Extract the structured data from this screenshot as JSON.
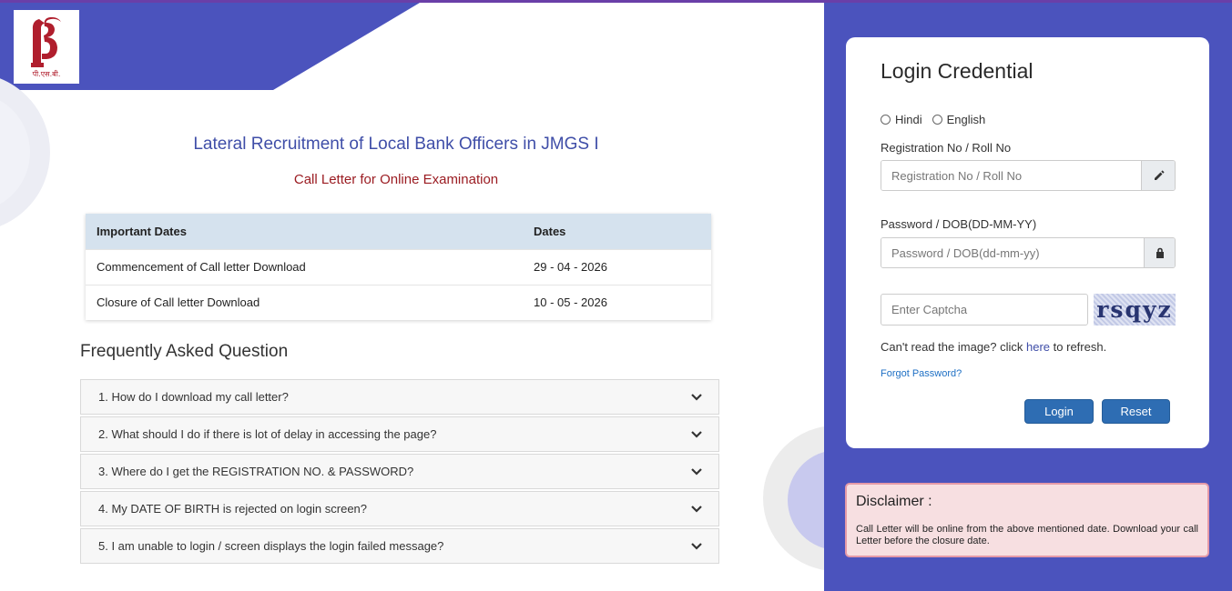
{
  "brand": {
    "logo_text": "पी.एस.बी.",
    "accent": "#4b53bd"
  },
  "header": {
    "title": "Lateral Recruitment of Local Bank Officers in JMGS I",
    "subtitle": "Call Letter for Online Examination"
  },
  "dates_table": {
    "columns": [
      "Important Dates",
      "Dates"
    ],
    "rows": [
      {
        "event": "Commencement of Call letter Download",
        "date": "29 - 04 - 2026"
      },
      {
        "event": "Closure of Call letter Download",
        "date": "10 - 05 - 2026"
      }
    ]
  },
  "faq": {
    "heading": "Frequently Asked Question",
    "items": [
      "1. How do I download my call letter?",
      "2. What should I do if there is lot of delay in accessing the page?",
      "3. Where do I get the REGISTRATION NO. & PASSWORD?",
      "4. My DATE OF BIRTH is rejected on login screen?",
      "5. I am unable to login / screen displays the login failed message?"
    ]
  },
  "login": {
    "title": "Login Credential",
    "languages": [
      "Hindi",
      "English"
    ],
    "reg_label": "Registration No / Roll No",
    "reg_placeholder": "Registration No / Roll No",
    "pwd_label": "Password / DOB(DD-MM-YY)",
    "pwd_placeholder": "Password / DOB(dd-mm-yy)",
    "captcha_placeholder": "Enter Captcha",
    "captcha_text": "rsqyz",
    "refresh_prefix": "Can't read the image? click ",
    "refresh_link": "here",
    "refresh_suffix": " to refresh.",
    "forgot": "Forgot Password?",
    "login_btn": "Login",
    "reset_btn": "Reset"
  },
  "disclaimer": {
    "title": "Disclaimer :",
    "text": "Call Letter will be online from the above mentioned date. Download your call Letter before the closure date."
  }
}
